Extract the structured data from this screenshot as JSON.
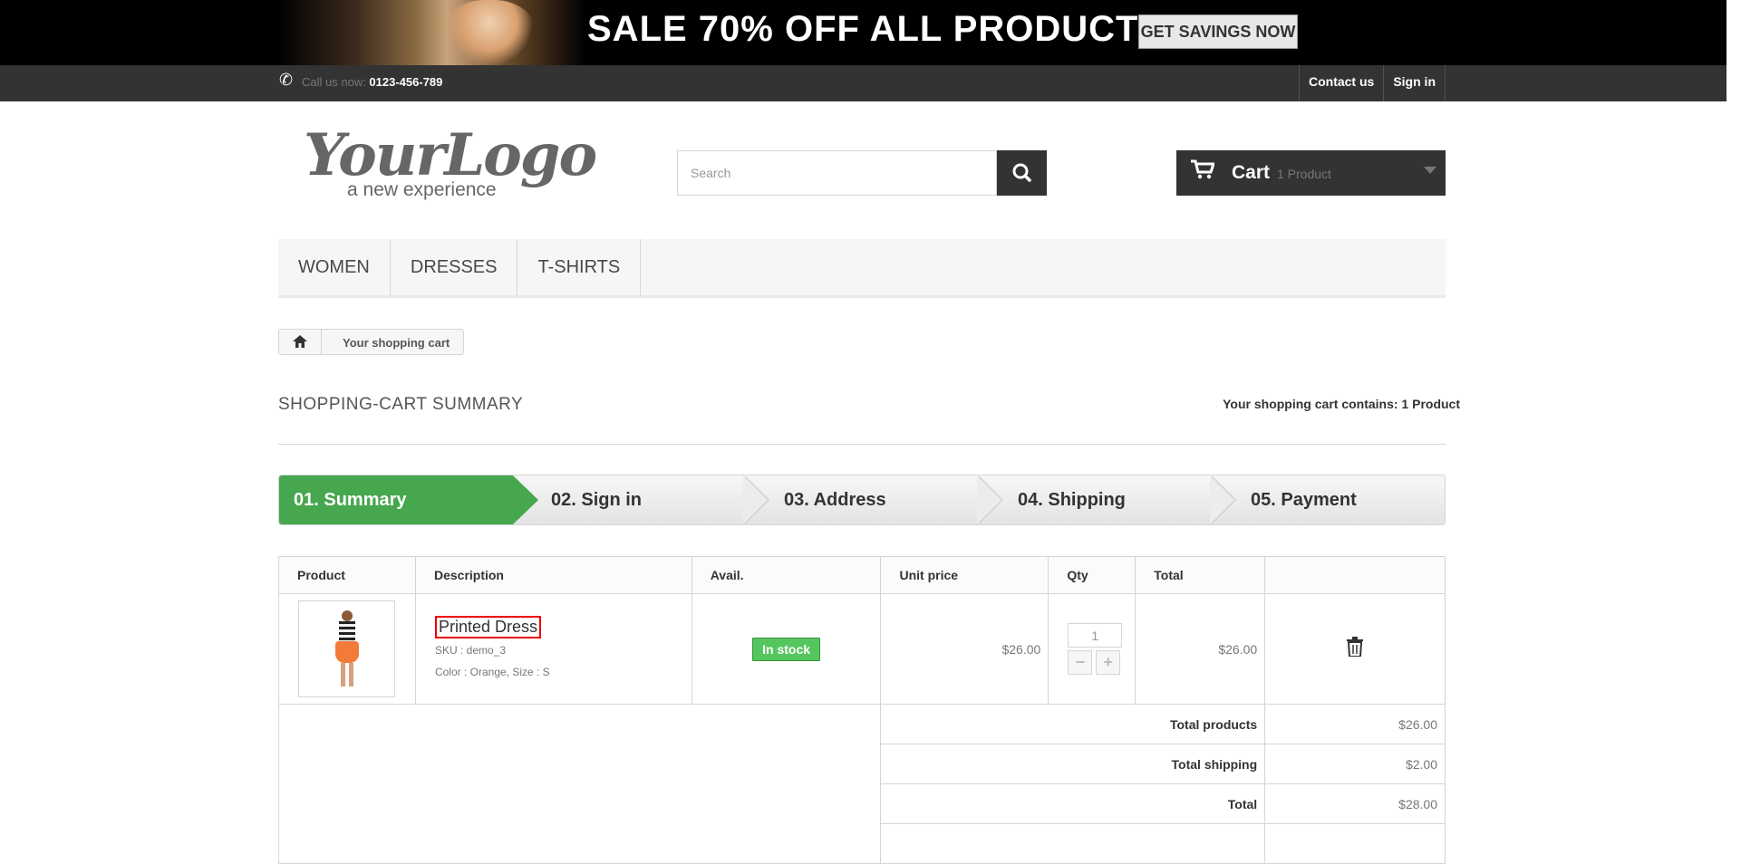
{
  "banner": {
    "text": "SALE 70% OFF ALL PRODUCTS",
    "button": "GET SAVINGS NOW"
  },
  "topbar": {
    "call_label": "Call us now: ",
    "phone": "0123-456-789",
    "contact": "Contact us",
    "signin": "Sign in"
  },
  "logo": {
    "main": "YourLogo",
    "tagline": "a new experience"
  },
  "search": {
    "placeholder": "Search"
  },
  "cart": {
    "label": "Cart",
    "count": "1 Product"
  },
  "menu": [
    "WOMEN",
    "DRESSES",
    "T-SHIRTS"
  ],
  "breadcrumb": {
    "current": "Your shopping cart"
  },
  "page": {
    "title": "SHOPPING-CART SUMMARY",
    "contains": "Your shopping cart contains: 1 Product"
  },
  "steps": [
    "01. Summary",
    "02. Sign in",
    "03. Address",
    "04. Shipping",
    "05. Payment"
  ],
  "table": {
    "headers": [
      "Product",
      "Description",
      "Avail.",
      "Unit price",
      "Qty",
      "Total"
    ],
    "item": {
      "name": "Printed Dress",
      "sku": "SKU : demo_3",
      "attrs": "Color : Orange, Size : S",
      "avail": "In stock",
      "unit_price": "$26.00",
      "qty": "1",
      "total": "$26.00"
    },
    "summary": [
      {
        "label": "Total products",
        "value": "$26.00"
      },
      {
        "label": "Total shipping",
        "value": "$2.00"
      },
      {
        "label": "Total",
        "value": "$28.00"
      }
    ]
  },
  "colors": {
    "accent_green": "#46a74e",
    "dark": "#333333"
  }
}
